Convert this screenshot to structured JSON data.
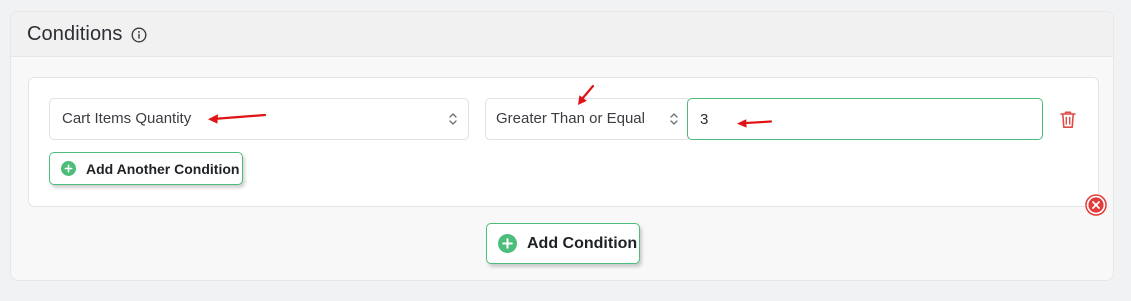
{
  "panel": {
    "title": "Conditions",
    "info_icon": "info-circle-icon"
  },
  "condition_row": {
    "field_select": {
      "value": "Cart Items Quantity"
    },
    "operator_select": {
      "value": "Greater Than or Equal"
    },
    "value_input": {
      "value": "3"
    },
    "delete_icon": "trash-icon"
  },
  "buttons": {
    "add_another_condition": "Add Another Condition",
    "add_condition": "Add Condition",
    "remove_group_icon": "close-circle-icon"
  },
  "colors": {
    "accent_green": "#4cbd7b",
    "delete_red": "#e04a44",
    "annotation_red": "#e01414"
  }
}
